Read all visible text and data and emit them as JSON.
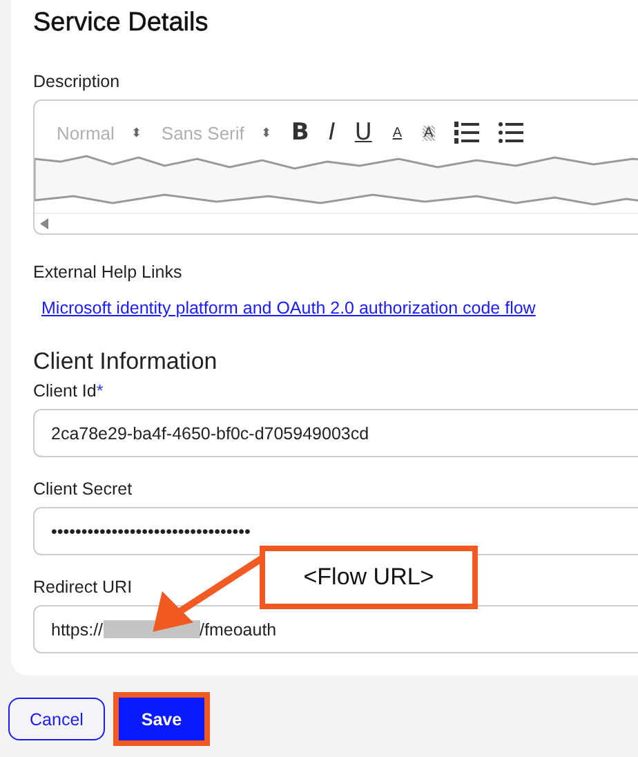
{
  "section_title": "Service Details",
  "description": {
    "label": "Description",
    "toolbar": [
      {
        "kind": "select",
        "label": "Normal",
        "caret": "⬍"
      },
      {
        "kind": "select",
        "label": "Sans Serif",
        "caret": "⬍"
      },
      {
        "kind": "bold",
        "label": "B"
      },
      {
        "kind": "italic",
        "label": "I"
      },
      {
        "kind": "underline",
        "label": "U"
      },
      {
        "kind": "color",
        "label": "A"
      },
      {
        "kind": "highlight",
        "label": "A"
      },
      {
        "kind": "ordered-list"
      },
      {
        "kind": "bullet-list"
      }
    ]
  },
  "help_links": {
    "label": "External Help Links",
    "links": [
      "Microsoft identity platform and OAuth 2.0 authorization code flow"
    ]
  },
  "client_section_title": "Client Information",
  "fields": [
    {
      "kind": "text",
      "label": "Client Id",
      "required_mark": "*",
      "value": "2ca78e29-ba4f-4650-bf0c-d705949003cd"
    },
    {
      "kind": "text",
      "label": "Client Secret",
      "value": "•••••••••••••••••••••••••••••••••"
    },
    {
      "kind": "redacted",
      "label": "Redirect URI",
      "value_start": "https://",
      "value_end": "/fmeoauth"
    }
  ],
  "callout": "<Flow URL>",
  "buttons": [
    {
      "label": "Cancel",
      "kind": "secondary",
      "highlighted": false
    },
    {
      "label": "Save",
      "kind": "primary",
      "highlighted": true
    }
  ]
}
